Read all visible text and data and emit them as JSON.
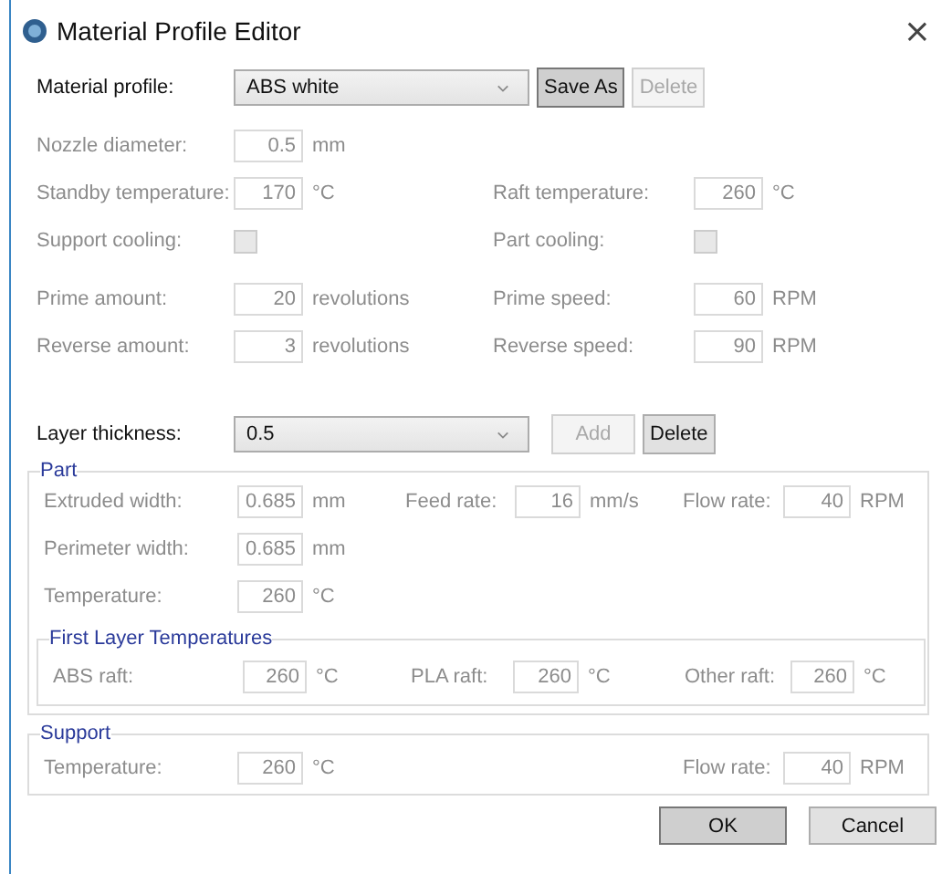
{
  "window": {
    "title": "Material Profile Editor",
    "close": "×"
  },
  "profile": {
    "label": "Material profile:",
    "value": "ABS white",
    "buttons": [
      {
        "label": "Save As",
        "disabled": false,
        "focused": true
      },
      {
        "label": "Delete",
        "disabled": true,
        "focused": false
      }
    ]
  },
  "settings": {
    "disabled": true,
    "rows": [
      [
        {
          "kind": "number",
          "label": "Nozzle diameter:",
          "value": "0.5",
          "unit": "mm"
        }
      ],
      [
        {
          "kind": "number",
          "label": "Standby temperature:",
          "value": "170",
          "unit": "°C"
        },
        {
          "kind": "number",
          "label": "Raft temperature:",
          "value": "260",
          "unit": "°C"
        }
      ],
      [
        {
          "kind": "checkbox",
          "label": "Support cooling:",
          "checked": false
        },
        {
          "kind": "checkbox",
          "label": "Part cooling:",
          "checked": false
        }
      ],
      [
        {
          "kind": "number",
          "label": "Prime amount:",
          "value": "20",
          "unit": "revolutions"
        },
        {
          "kind": "number",
          "label": "Prime speed:",
          "value": "60",
          "unit": "RPM"
        }
      ],
      [
        {
          "kind": "number",
          "label": "Reverse amount:",
          "value": "3",
          "unit": "revolutions"
        },
        {
          "kind": "number",
          "label": "Reverse speed:",
          "value": "90",
          "unit": "RPM"
        }
      ]
    ]
  },
  "layer": {
    "label": "Layer thickness:",
    "value": "0.5",
    "buttons": [
      {
        "label": "Add",
        "disabled": true,
        "focused": false
      },
      {
        "label": "Delete",
        "disabled": false,
        "focused": false
      }
    ]
  },
  "part": {
    "title": "Part",
    "disabled": true,
    "rows": [
      [
        {
          "label": "Extruded width:",
          "value": "0.685",
          "unit": "mm"
        },
        {
          "label": "Feed rate:",
          "value": "16",
          "unit": "mm/s"
        },
        {
          "label": "Flow rate:",
          "value": "40",
          "unit": "RPM"
        }
      ],
      [
        {
          "label": "Perimeter width:",
          "value": "0.685",
          "unit": "mm"
        }
      ],
      [
        {
          "label": "Temperature:",
          "value": "260",
          "unit": "°C"
        }
      ]
    ],
    "first_layer": {
      "title": "First Layer Temperatures",
      "fields": [
        {
          "label": "ABS raft:",
          "value": "260",
          "unit": "°C"
        },
        {
          "label": "PLA raft:",
          "value": "260",
          "unit": "°C"
        },
        {
          "label": "Other raft:",
          "value": "260",
          "unit": "°C"
        }
      ]
    }
  },
  "support": {
    "title": "Support",
    "disabled": true,
    "fields": [
      {
        "label": "Temperature:",
        "value": "260",
        "unit": "°C"
      },
      {
        "label": "Flow rate:",
        "value": "40",
        "unit": "RPM"
      }
    ]
  },
  "buttons": [
    {
      "label": "OK",
      "focused": true
    },
    {
      "label": "Cancel",
      "focused": false
    }
  ]
}
